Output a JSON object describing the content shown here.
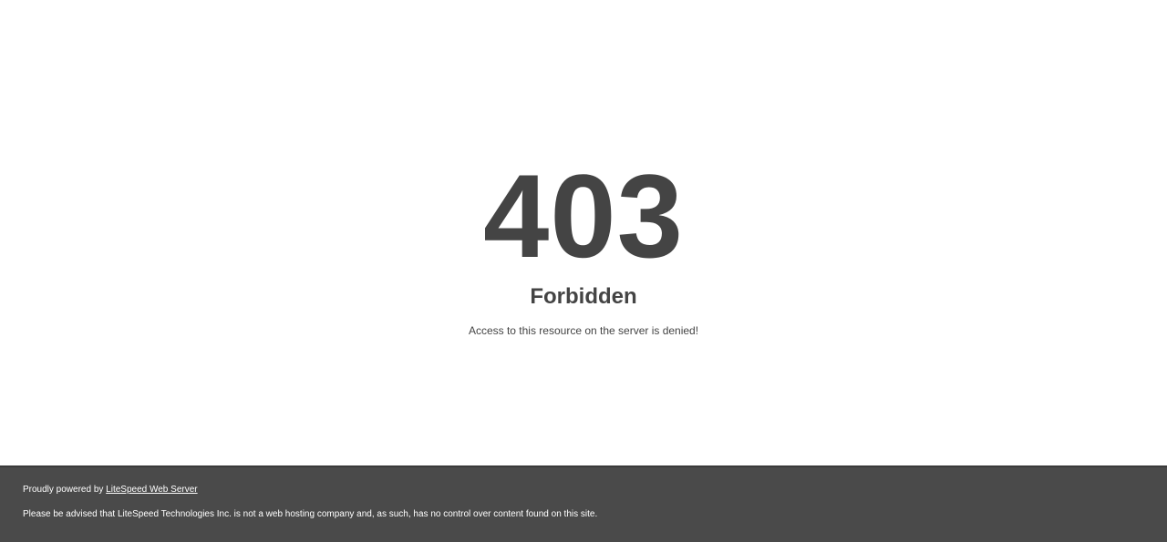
{
  "error": {
    "code": "403",
    "title": "Forbidden",
    "message": "Access to this resource on the server is denied!"
  },
  "footer": {
    "powered_prefix": "Proudly powered by ",
    "powered_link": "LiteSpeed Web Server",
    "disclaimer": "Please be advised that LiteSpeed Technologies Inc. is not a web hosting company and, as such, has no control over content found on this site."
  },
  "colors": {
    "text": "#444444",
    "footer_bg": "#4a4a4a",
    "footer_text": "#ffffff"
  }
}
